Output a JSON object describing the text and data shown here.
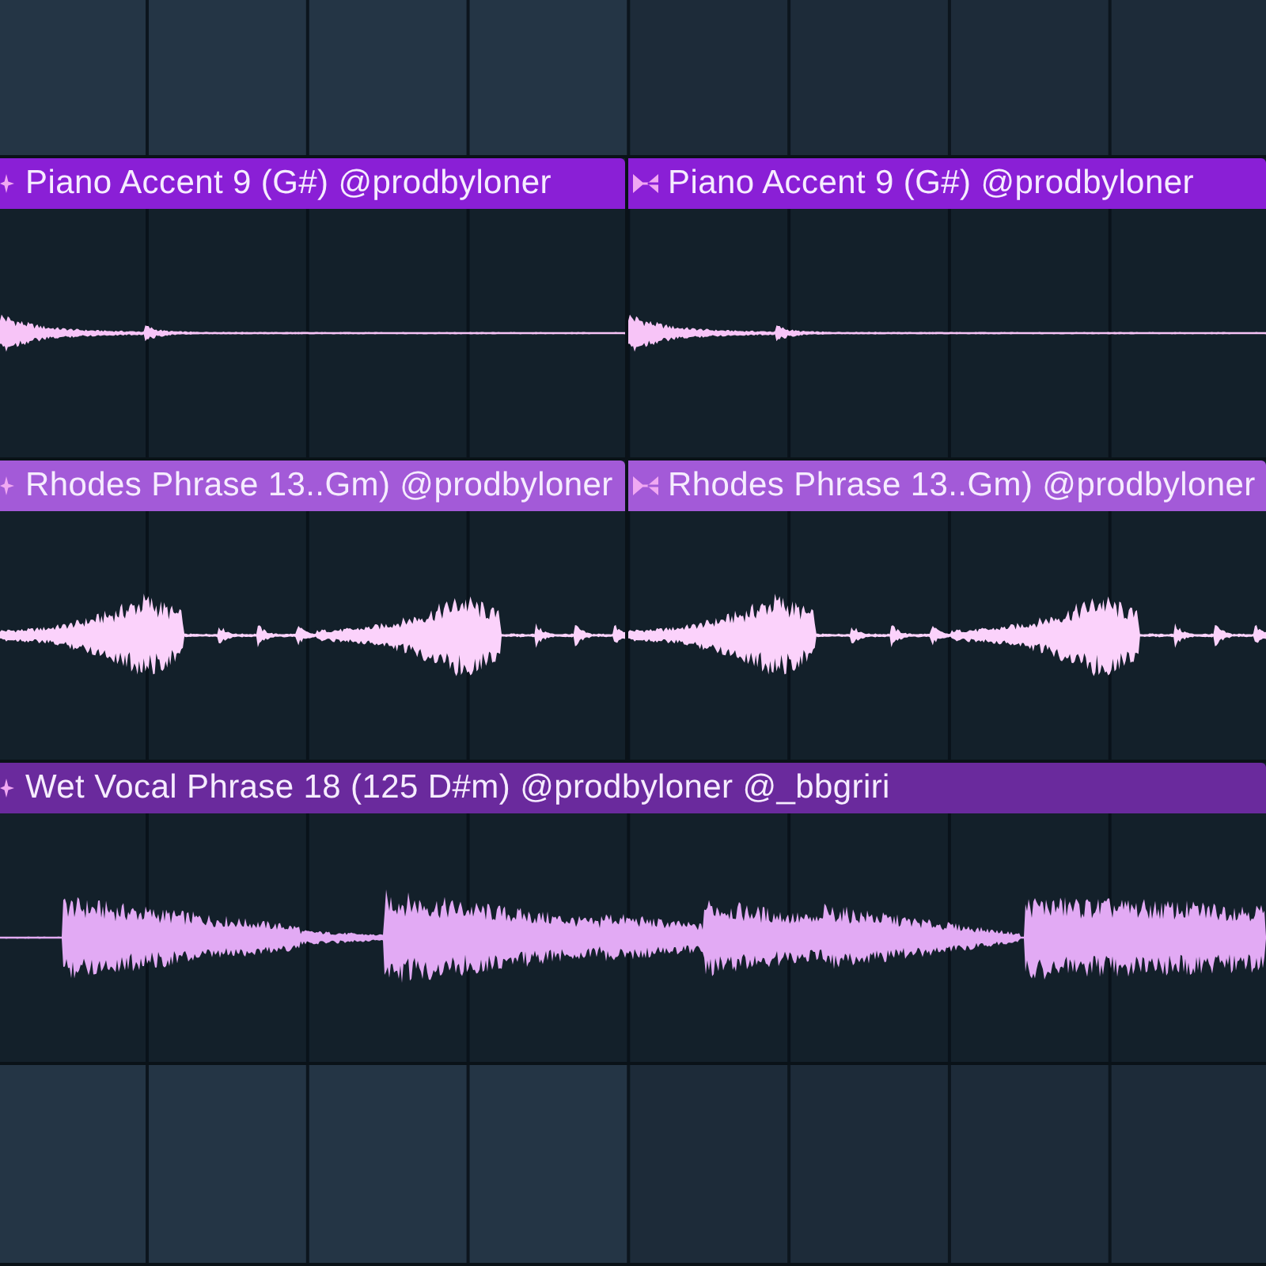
{
  "tracks": [
    {
      "kind": "empty"
    },
    {
      "kind": "audio",
      "clips": [
        {
          "title": "Piano Accent 9 (G#) @prodbyloner",
          "color": "#8a1fd6"
        },
        {
          "title": "Piano Accent 9 (G#) @prodbyloner",
          "color": "#8a1fd6"
        }
      ]
    },
    {
      "kind": "audio",
      "clips": [
        {
          "title": "Rhodes Phrase 13..Gm) @prodbyloner",
          "color": "#a35ad8"
        },
        {
          "title": "Rhodes Phrase 13..Gm) @prodbyloner",
          "color": "#a35ad8"
        }
      ]
    },
    {
      "kind": "audio",
      "clips": [
        {
          "title": "Wet Vocal Phrase 18 (125 D#m) @prodbyloner @_bbgriri",
          "color": "#6a2a9d"
        }
      ]
    },
    {
      "kind": "empty"
    }
  ]
}
